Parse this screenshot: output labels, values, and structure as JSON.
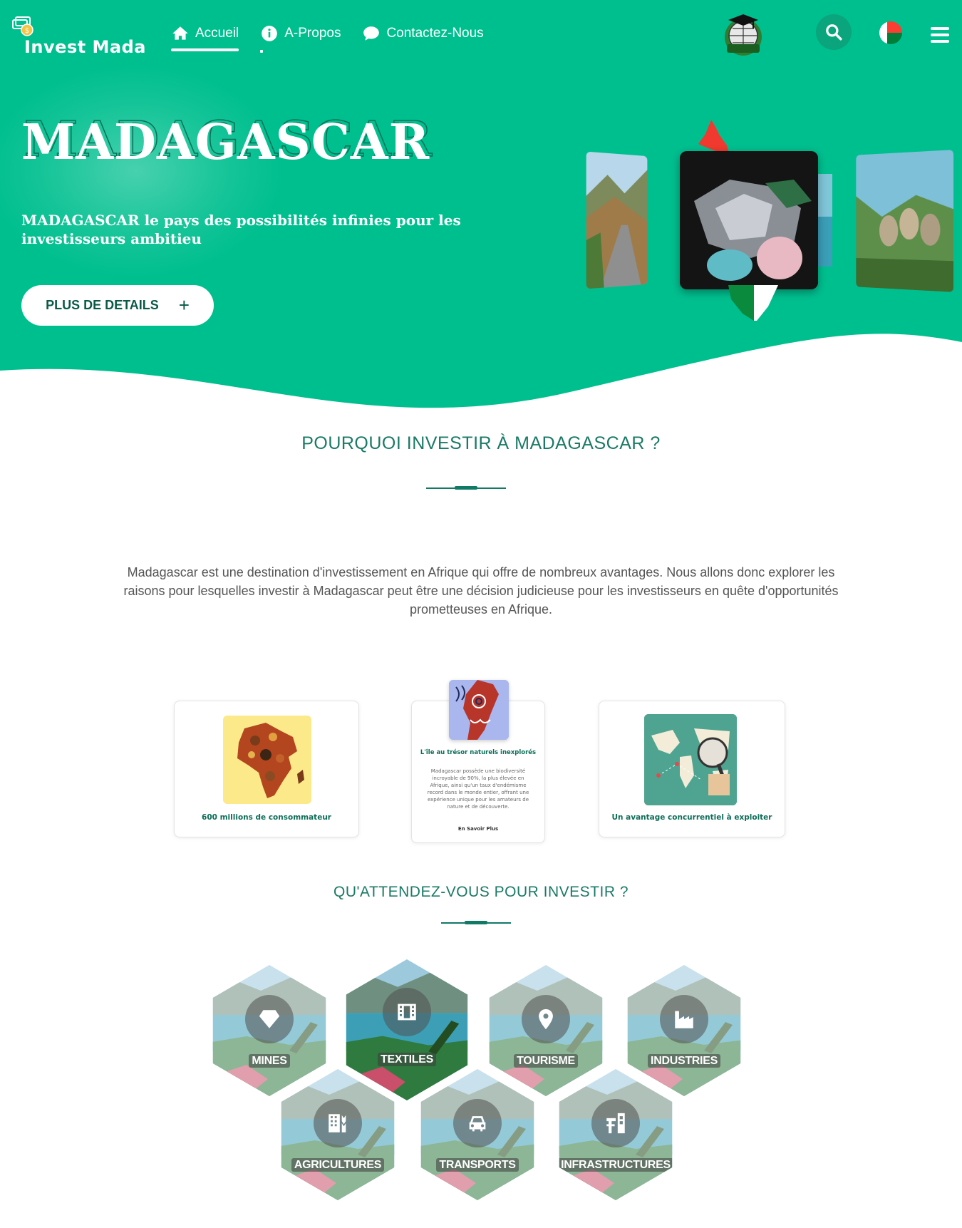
{
  "brand": {
    "name": "Invest Mada"
  },
  "nav": {
    "items": [
      {
        "label": "Accueil",
        "icon": "home-icon",
        "active": true
      },
      {
        "label": "A-Propos",
        "icon": "info-icon",
        "active": false
      },
      {
        "label": "Contactez-Nous",
        "icon": "chat-icon",
        "active": false
      }
    ]
  },
  "hero": {
    "title": "MADAGASCAR",
    "subtitle": "MADAGASCAR le pays des possibilités infinies pour les investisseurs ambitieu",
    "cta_label": "PLUS DE DETAILS",
    "cta_icon": "+"
  },
  "why": {
    "title": "POURQUOI INVESTIR À MADAGASCAR ?",
    "intro": "Madagascar est une destination d'investissement en Afrique qui offre de nombreux avantages. Nous allons donc explorer les raisons pour lesquelles investir à Madagascar peut être une décision judicieuse pour les investisseurs en quête d'opportunités prometteuses en Afrique.",
    "cards": [
      {
        "caption": "600 millions de consommateur"
      },
      {
        "caption": "L'île au trésor naturels inexplorés",
        "description": "Madagascar possède une biodiversité incroyable de 90%, la plus élevée en Afrique, ainsi qu'un taux d'endémisme record dans le monde entier, offrant une expérience unique pour les amateurs de nature et de découverte.",
        "link": "En Savoir Plus"
      },
      {
        "caption": "Un avantage concurrentiel à exploiter"
      }
    ]
  },
  "sectors": {
    "title": "QU'ATTENDEZ-VOUS POUR INVESTIR ?",
    "items": [
      {
        "label": "MINES",
        "icon": "diamond-icon"
      },
      {
        "label": "TEXTILES",
        "icon": "film-icon",
        "active": true
      },
      {
        "label": "TOURISME",
        "icon": "map-pin-icon"
      },
      {
        "label": "INDUSTRIES",
        "icon": "factory-icon"
      },
      {
        "label": "AGRICULTURES",
        "icon": "building-wheat-icon"
      },
      {
        "label": "TRANSPORTS",
        "icon": "car-icon"
      },
      {
        "label": "INFRASTRUCTURES",
        "icon": "road-works-icon"
      }
    ]
  },
  "colors": {
    "primary": "#00bf8f",
    "dark": "#117a65",
    "text_green": "#1a7a66",
    "flag_red": "#fc3d32",
    "flag_green": "#007e3a"
  }
}
